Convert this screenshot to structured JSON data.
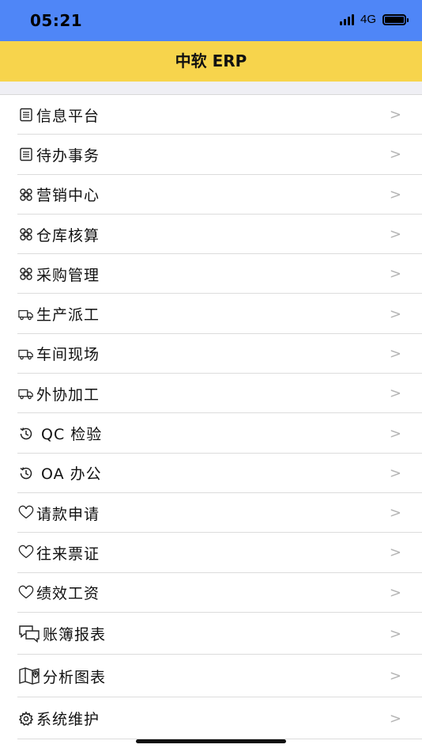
{
  "status_bar": {
    "time": "05:21",
    "network": "4G"
  },
  "nav": {
    "title": "中软 ERP"
  },
  "menu": {
    "items": [
      {
        "icon": "document-icon",
        "label": "信息平台"
      },
      {
        "icon": "document-icon",
        "label": "待办事务"
      },
      {
        "icon": "command-icon",
        "label": "营销中心"
      },
      {
        "icon": "command-icon",
        "label": "仓库核算"
      },
      {
        "icon": "command-icon",
        "label": "采购管理"
      },
      {
        "icon": "truck-icon",
        "label": "生产派工"
      },
      {
        "icon": "truck-icon",
        "label": "车间现场"
      },
      {
        "icon": "truck-icon",
        "label": "外协加工"
      },
      {
        "icon": "history-icon",
        "label": "QC 检验"
      },
      {
        "icon": "history-icon",
        "label": "OA 办公"
      },
      {
        "icon": "heart-icon",
        "label": "请款申请"
      },
      {
        "icon": "heart-icon",
        "label": "往来票证"
      },
      {
        "icon": "heart-icon",
        "label": "绩效工资"
      },
      {
        "icon": "chat-bubbles-icon",
        "label": "账簿报表"
      },
      {
        "icon": "map-icon",
        "label": "分析图表"
      },
      {
        "icon": "gear-icon",
        "label": "系统维护"
      }
    ],
    "chevron": ">"
  }
}
